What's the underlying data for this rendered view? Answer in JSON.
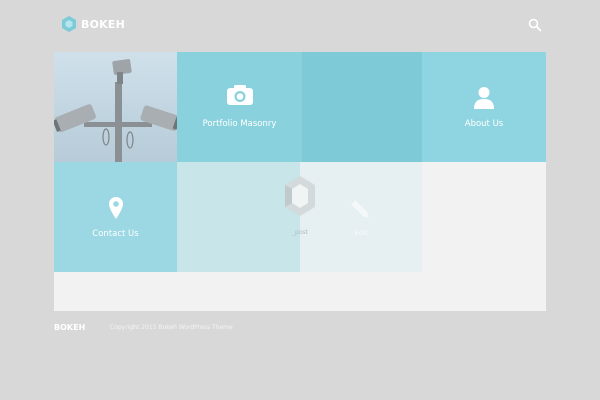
{
  "site": {
    "name": "BOKEH",
    "colors": {
      "background": "#d8d8d8",
      "accent": "#89d2dd",
      "accent_dark": "#7ecad6",
      "panel": "#f2f2f2"
    }
  },
  "header": {
    "search_icon": "search-icon"
  },
  "tiles": {
    "portfolio": {
      "label": "Portfolio Masonry",
      "icon": "camera-icon"
    },
    "about": {
      "label": "About Us",
      "icon": "user-icon"
    },
    "contact": {
      "label": "Contact Us",
      "icon": "map-pin-icon"
    },
    "blog": {
      "label": "_post",
      "icon": "bokeh-logo-icon"
    },
    "edit": {
      "label": "Edit",
      "icon": "pencil-icon"
    }
  },
  "footer": {
    "brand": "BOKEH",
    "copyright": "Copyright 2015 Bokeh WordPress Theme"
  }
}
